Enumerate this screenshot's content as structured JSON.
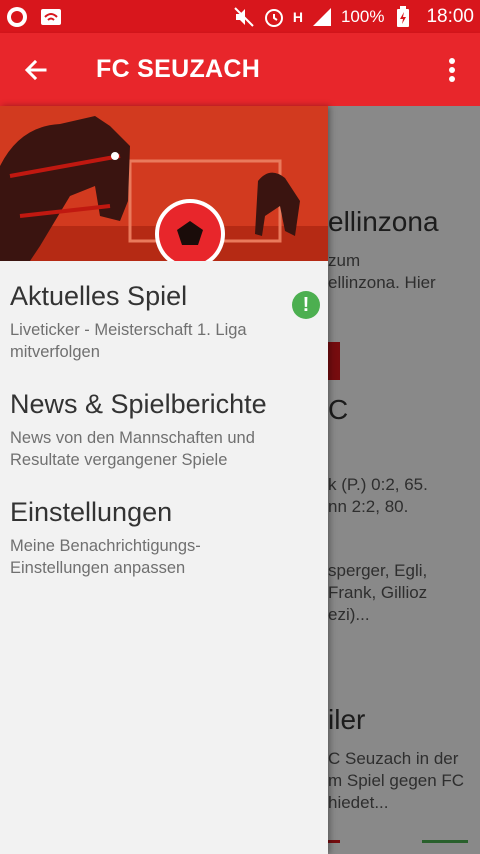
{
  "statusbar": {
    "battery": "100%",
    "network": "H",
    "time": "18:00"
  },
  "appbar": {
    "title": "FC SEUZACH",
    "back_icon": "arrow-left-icon",
    "menu_icon": "more-vert-icon"
  },
  "background": {
    "heading1": "ellinzona",
    "para1_line1": "zum",
    "para1_line2": "ellinzona. Hier",
    "c_fragment": "C",
    "para2_line1": "k (P.) 0:2, 65.",
    "para2_line2": "nn 2:2, 80.",
    "para3_line1": "sperger, Egli,",
    "para3_line2": "Frank, Gillioz",
    "para3_line3": "ezi)...",
    "heading2": "iler",
    "para4_line1": "C Seuzach in der",
    "para4_line2": "m Spiel gegen FC",
    "para4_line3": "hiedet...",
    "badge_color": "#d8161c"
  },
  "drawer": {
    "items": [
      {
        "title": "Aktuelles Spiel",
        "subtitle_line1": "Liveticker - Meisterschaft 1. Liga",
        "subtitle_line2": "mitverfolgen",
        "badge": "!"
      },
      {
        "title": "News & Spielberichte",
        "subtitle_line1": "News von den Mannschaften und",
        "subtitle_line2": "Resultate vergangener Spiele"
      },
      {
        "title": "Einstellungen",
        "subtitle_line1": "Meine Benachrichtigungs-",
        "subtitle_line2": "Einstellungen anpassen"
      }
    ]
  },
  "colors": {
    "primary": "#e8262b",
    "status": "#d8161c",
    "alert": "#4caf50"
  }
}
